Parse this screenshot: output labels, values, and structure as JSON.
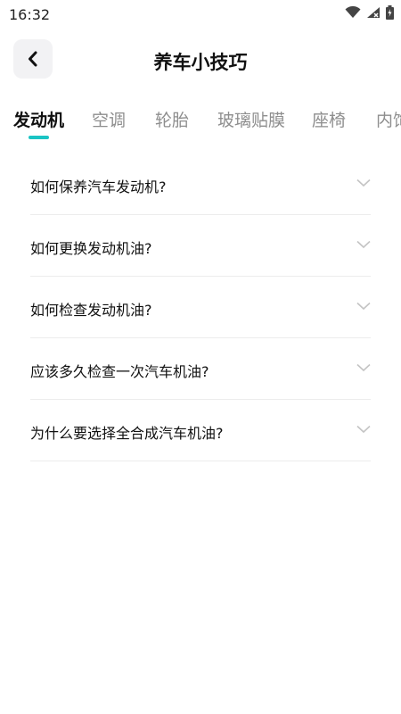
{
  "status_bar": {
    "time": "16:32",
    "icons": [
      "wifi-icon",
      "signal-icon",
      "battery-icon"
    ]
  },
  "header": {
    "back_icon": "chevron-left-icon",
    "title": "养车小技巧"
  },
  "tabs": [
    {
      "label": "发动机",
      "active": true
    },
    {
      "label": "空调",
      "active": false
    },
    {
      "label": "轮胎",
      "active": false
    },
    {
      "label": "玻璃贴膜",
      "active": false
    },
    {
      "label": "座椅",
      "active": false
    },
    {
      "label": "内饰",
      "active": false
    }
  ],
  "accent_color": "#1bc4c4",
  "faq": [
    {
      "question": "如何保养汽车发动机?"
    },
    {
      "question": "如何更换发动机油?"
    },
    {
      "question": "如何检查发动机油?"
    },
    {
      "question": "应该多久检查一次汽车机油?"
    },
    {
      "question": "为什么要选择全合成汽车机油?"
    }
  ]
}
